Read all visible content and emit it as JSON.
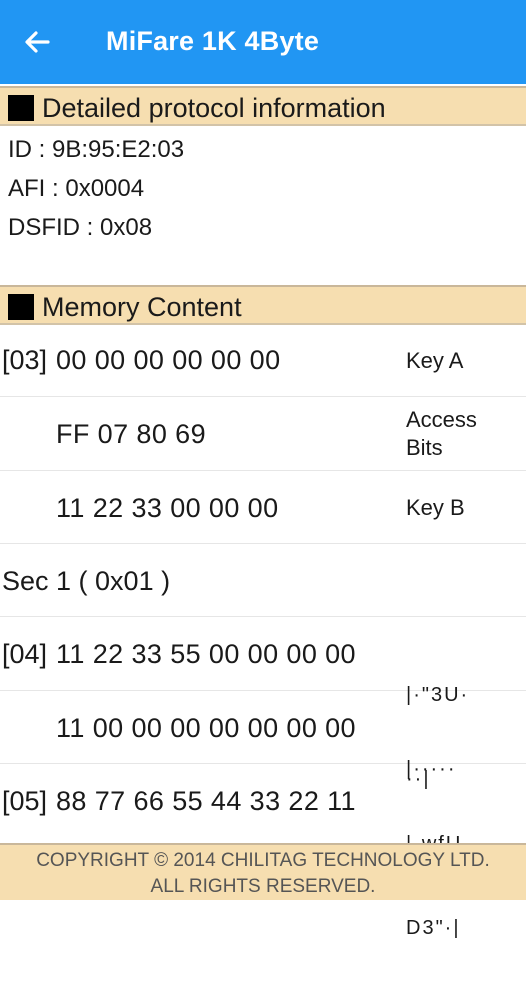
{
  "header": {
    "title": "MiFare 1K 4Byte",
    "back_icon": "arrow-left-icon"
  },
  "protocol": {
    "heading": "Detailed protocol information",
    "lines": [
      "ID : 9B:95:E2:03",
      "AFI : 0x0004",
      "DSFID : 0x08"
    ]
  },
  "memory": {
    "heading": "Memory Content",
    "rows": [
      {
        "index": "[03]",
        "hex": "00 00 00 00 00 00",
        "desc": [
          "Key A"
        ]
      },
      {
        "index": "",
        "hex": "FF 07 80 69",
        "desc": [
          "Access",
          "Bits"
        ]
      },
      {
        "index": "",
        "hex": "11 22 33 00 00 00",
        "desc": [
          "Key B"
        ]
      },
      {
        "sector": "Sec 1 ( 0x01 )"
      },
      {
        "index": "[04]",
        "hex": "11 22 33 55 00 00 00 00",
        "ascii": [
          "|·\"3U·",
          "··|"
        ]
      },
      {
        "index": "",
        "hex": "11 00 00 00 00 00 00 00",
        "ascii": [
          "|·····",
          "··|"
        ]
      },
      {
        "index": "[05]",
        "hex": "88 77 66 55 44 33 22 11",
        "ascii": [
          "|·wfU",
          "D3\"·|"
        ]
      }
    ]
  },
  "footer": {
    "line1": "COPYRIGHT © 2014 CHILITAG TECHNOLOGY LTD.",
    "line2": "ALL RIGHTS RESERVED."
  },
  "colors": {
    "appbar": "#2196f3",
    "section_header": "#f6deb0"
  }
}
